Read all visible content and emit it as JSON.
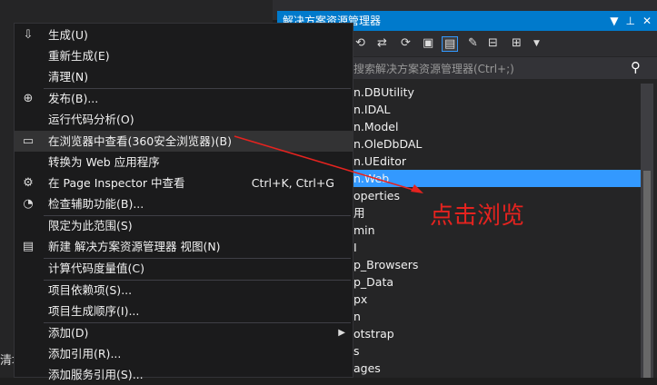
{
  "background": {
    "bottom_text": "清填"
  },
  "solution_explorer": {
    "title": "解决方案资源管理器",
    "title_buttons": [
      "▼",
      "⊥",
      "✕"
    ],
    "search_placeholder": "搜索解决方案资源管理器(Ctrl+;)",
    "tree_items": [
      {
        "label": "n.DBUtility",
        "selected": false
      },
      {
        "label": "n.IDAL",
        "selected": false
      },
      {
        "label": "n.Model",
        "selected": false
      },
      {
        "label": "n.OleDbDAL",
        "selected": false
      },
      {
        "label": "n.UEditor",
        "selected": false
      },
      {
        "label": "n.Web",
        "selected": true
      },
      {
        "label": "operties",
        "selected": false
      },
      {
        "label": "用",
        "selected": false
      },
      {
        "label": "min",
        "selected": false
      },
      {
        "label": "I",
        "selected": false
      },
      {
        "label": "p_Browsers",
        "selected": false
      },
      {
        "label": "p_Data",
        "selected": false
      },
      {
        "label": "px",
        "selected": false
      },
      {
        "label": "n",
        "selected": false
      },
      {
        "label": "otstrap",
        "selected": false
      },
      {
        "label": "s",
        "selected": false
      },
      {
        "label": "ages",
        "selected": false
      }
    ]
  },
  "context_menu": {
    "items": [
      {
        "label": "生成(U)",
        "icon": "build-icon",
        "glyph": "⇩",
        "shortcut": ""
      },
      {
        "label": "重新生成(E)",
        "icon": "",
        "glyph": "",
        "shortcut": ""
      },
      {
        "label": "清理(N)",
        "icon": "",
        "glyph": "",
        "shortcut": ""
      },
      {
        "label": "发布(B)...",
        "icon": "publish-icon",
        "glyph": "⊕",
        "shortcut": ""
      },
      {
        "label": "运行代码分析(O)",
        "icon": "",
        "glyph": "",
        "shortcut": ""
      },
      {
        "label": "在浏览器中查看(360安全浏览器)(B)",
        "icon": "browser-icon",
        "glyph": "▭",
        "shortcut": "",
        "highlight": true
      },
      {
        "label": "转换为 Web 应用程序",
        "icon": "",
        "glyph": "",
        "shortcut": ""
      },
      {
        "label": "在 Page Inspector 中查看",
        "icon": "page-inspector-icon",
        "glyph": "⚙",
        "shortcut": "Ctrl+K, Ctrl+G"
      },
      {
        "label": "检查辅助功能(B)...",
        "icon": "accessibility-icon",
        "glyph": "◔",
        "shortcut": ""
      },
      {
        "label": "限定为此范围(S)",
        "icon": "",
        "glyph": "",
        "shortcut": ""
      },
      {
        "label": "新建 解决方案资源管理器 视图(N)",
        "icon": "new-view-icon",
        "glyph": "▤",
        "shortcut": ""
      },
      {
        "label": "计算代码度量值(C)",
        "icon": "",
        "glyph": "",
        "shortcut": ""
      },
      {
        "label": "项目依赖项(S)...",
        "icon": "",
        "glyph": "",
        "shortcut": ""
      },
      {
        "label": "项目生成顺序(I)...",
        "icon": "",
        "glyph": "",
        "shortcut": ""
      },
      {
        "label": "添加(D)",
        "icon": "",
        "glyph": "",
        "shortcut": "",
        "submenu": true
      },
      {
        "label": "添加引用(R)...",
        "icon": "",
        "glyph": "",
        "shortcut": ""
      },
      {
        "label": "添加服务引用(S)...",
        "icon": "",
        "glyph": "",
        "shortcut": ""
      }
    ]
  },
  "annotation": {
    "text": "点击浏览",
    "color": "#e5231f"
  }
}
